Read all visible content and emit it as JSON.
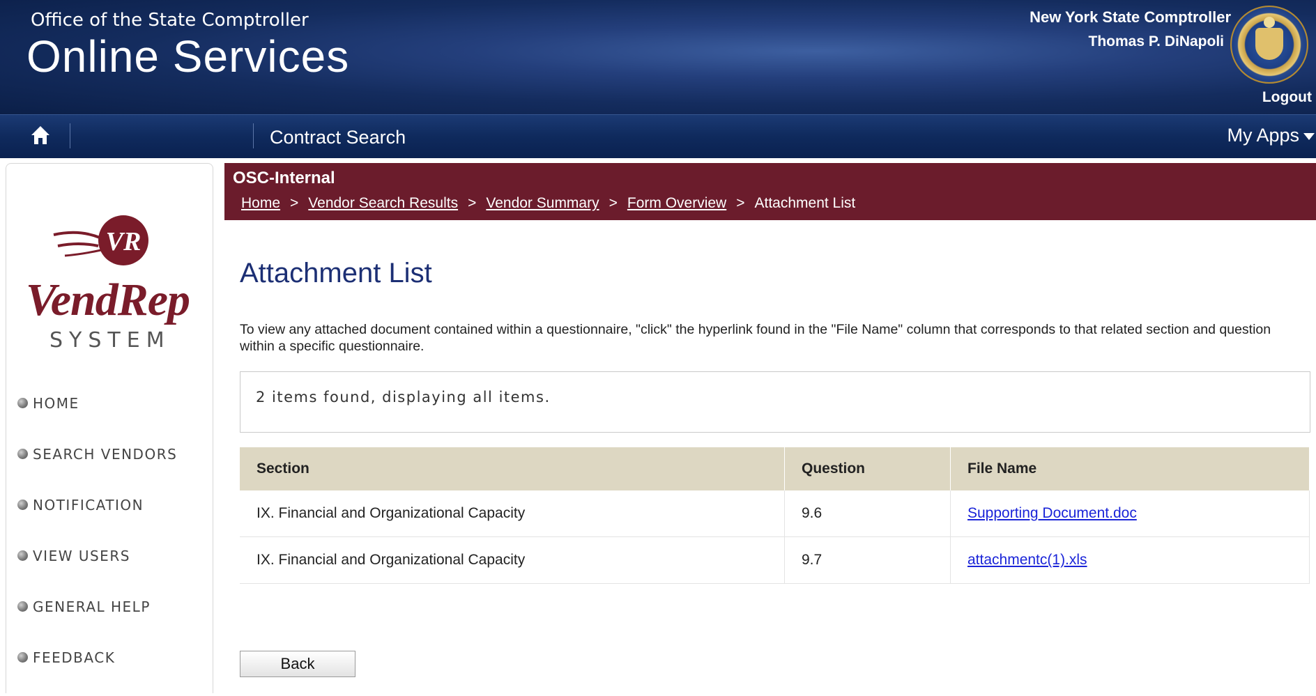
{
  "header": {
    "office_line": "Office of the State Comptroller",
    "title": "Online Services",
    "comptroller_title": "New York State Comptroller",
    "comptroller_name": "Thomas P. DiNapoli",
    "logout": "Logout"
  },
  "navbar": {
    "home_icon": "home-icon",
    "contract_search": "Contract Search",
    "my_apps": "My Apps"
  },
  "sidebar": {
    "logo_badge": "VR",
    "logo_title": "VendRep",
    "logo_subtitle": "SYSTEM",
    "items": [
      {
        "label": "HOME"
      },
      {
        "label": "SEARCH VENDORS"
      },
      {
        "label": "NOTIFICATION"
      },
      {
        "label": "VIEW USERS"
      },
      {
        "label": "GENERAL HELP"
      },
      {
        "label": "FEEDBACK"
      }
    ]
  },
  "context": {
    "name": "OSC-Internal",
    "breadcrumb": [
      {
        "label": "Home"
      },
      {
        "label": "Vendor Search Results"
      },
      {
        "label": "Vendor Summary"
      },
      {
        "label": "Form Overview"
      },
      {
        "label": "Attachment List"
      }
    ]
  },
  "main": {
    "title": "Attachment List",
    "instructions": "To view any attached document contained within a questionnaire, \"click\" the hyperlink found in the \"File Name\" column that corresponds to that related section and question within a specific questionnaire.",
    "items_found": "2 items found, displaying all items.",
    "table": {
      "headers": [
        "Section",
        "Question",
        "File Name"
      ],
      "rows": [
        {
          "section": "IX.  Financial and Organizational Capacity",
          "question": "9.6",
          "file": "Supporting Document.doc"
        },
        {
          "section": "IX.  Financial and Organizational Capacity",
          "question": "9.7",
          "file": "attachmentc(1).xls"
        }
      ]
    },
    "back_button": "Back"
  },
  "colors": {
    "header_blue": "#142c5e",
    "context_maroon": "#6b1c2c",
    "title_blue": "#1c2f74",
    "link_blue": "#1a24d8",
    "table_header": "#ddd7c2"
  }
}
